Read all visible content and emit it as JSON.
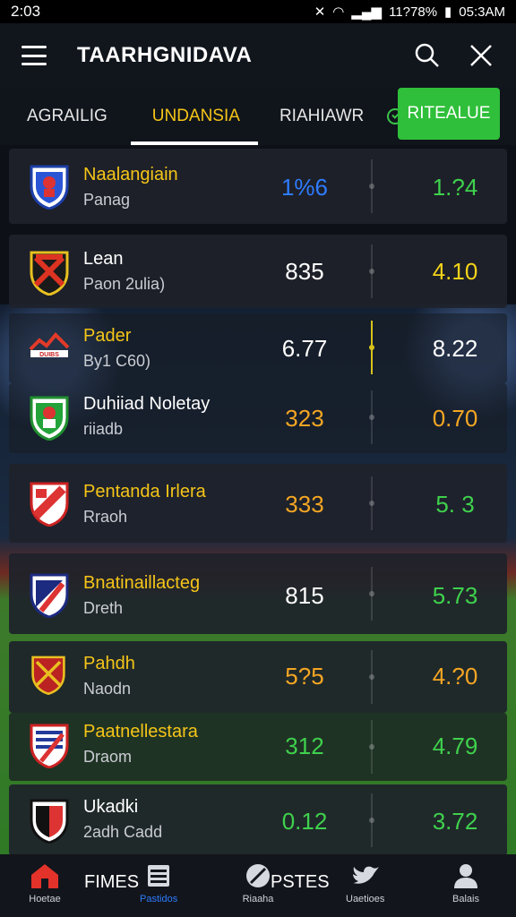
{
  "status": {
    "time": "2:03",
    "battery": "11?78%",
    "clock": "05:3AM"
  },
  "header": {
    "title": "TAARHGNIDAVA"
  },
  "tabs": [
    {
      "label": "AGRAILIG"
    },
    {
      "label": "UNDANSIA"
    },
    {
      "label": "RIAHIAWR"
    }
  ],
  "live_button": "RITEALUE",
  "rows": [
    {
      "name": "Naalangiain",
      "sub": "Panag",
      "v1": "1%6",
      "v2": "1.?4",
      "v1_color": "#2e7bff",
      "v2_color": "#3fd14d",
      "crest": "shield-blue-icon"
    },
    {
      "name": "Lean",
      "sub": "Paon 2ulia)",
      "v1": "835",
      "v2": "4.10",
      "v1_color": "#ffffff",
      "v2_color": "#f5d31a",
      "crest": "shield-red-yellow-icon"
    },
    {
      "name": "Pader",
      "sub": "By1 C60)",
      "v1": "6.77",
      "v2": "8.22",
      "v1_color": "#ffffff",
      "v2_color": "#ffffff",
      "crest": "club-logo-icon"
    },
    {
      "name": "Duhiiad Noletay",
      "sub": "riiadb",
      "v1": "323",
      "v2": "0.70",
      "v1_color": "#f5a623",
      "v2_color": "#f5a623",
      "crest": "shield-green-icon"
    },
    {
      "name": "Pentanda Irlera",
      "sub": "Rraoh",
      "v1": "333",
      "v2": "5. 3",
      "v1_color": "#f5a623",
      "v2_color": "#3fd14d",
      "crest": "shield-red-white-icon"
    },
    {
      "name": "Bnatinaillacteg",
      "sub": "Dreth",
      "v1": "815",
      "v2": "5.73",
      "v1_color": "#ffffff",
      "v2_color": "#3fd14d",
      "crest": "shield-navy-red-icon"
    },
    {
      "name": "Pahdh",
      "sub": "Naodn",
      "v1": "5?5",
      "v2": "4.?0",
      "v1_color": "#f5a623",
      "v2_color": "#f5a623",
      "crest": "shield-red-gold-icon"
    },
    {
      "name": "Paatnellestara",
      "sub": "Draom",
      "v1": "312",
      "v2": "4.79",
      "v1_color": "#3fd14d",
      "v2_color": "#3fd14d",
      "crest": "shield-stripes-icon"
    },
    {
      "name": "Ukadki",
      "sub": "2adh Cadd",
      "v1": "0.12",
      "v2": "3.72",
      "v1_color": "#3fd14d",
      "v2_color": "#3fd14d",
      "crest": "shield-red-black-icon"
    }
  ],
  "nav": {
    "home": "Hoetae",
    "fixtures_big": "FIMES",
    "fixtures": "Pastidos",
    "posts_big": "PSTES",
    "posts": "Riaaha",
    "social": "Uaetioes",
    "profile": "Balais"
  }
}
